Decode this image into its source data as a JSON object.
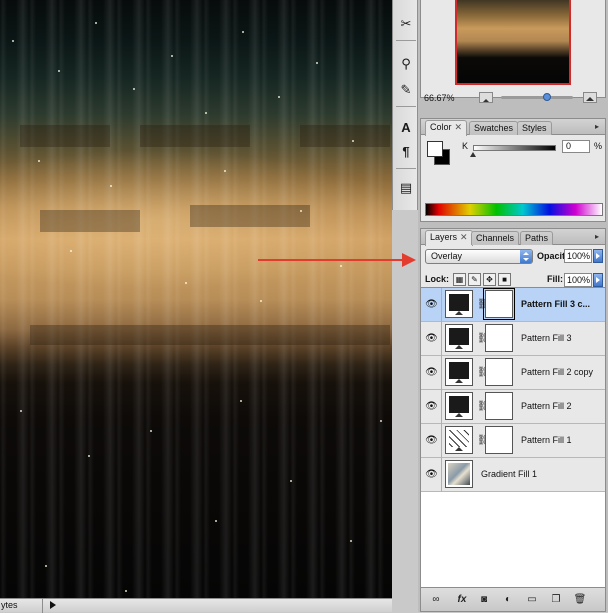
{
  "statusbar": {
    "text": "ytes"
  },
  "navigator": {
    "zoom": "66.67%"
  },
  "color_panel": {
    "tabs": [
      "Color",
      "Swatches",
      "Styles"
    ],
    "k_label": "K",
    "k_value": "0",
    "k_unit": "%"
  },
  "layers_panel": {
    "tabs": [
      "Layers",
      "Channels",
      "Paths"
    ],
    "blend_mode": "Overlay",
    "opacity_label": "Opacity:",
    "opacity_value": "100%",
    "lock_label": "Lock:",
    "fill_label": "Fill:",
    "fill_value": "100%",
    "layers": [
      {
        "name": "Pattern Fill 3 c..."
      },
      {
        "name": "Pattern Fill 3"
      },
      {
        "name": "Pattern Fill 2 copy"
      },
      {
        "name": "Pattern Fill 2"
      },
      {
        "name": "Pattern Fill 1"
      },
      {
        "name": "Gradient Fill 1"
      }
    ]
  },
  "icons": {
    "tools": [
      "scissors-icon",
      "stamp-icon",
      "history-brush-icon",
      "character-icon",
      "paragraph-icon",
      "notes-icon"
    ],
    "layer_bottom": [
      "link-icon",
      "fx-icon",
      "mask-icon",
      "adjustment-icon",
      "group-icon",
      "new-layer-icon",
      "trash-icon"
    ]
  },
  "colors": {
    "annotation_arrow": "#e33b2e",
    "selected_layer": "#b8d3f6"
  }
}
